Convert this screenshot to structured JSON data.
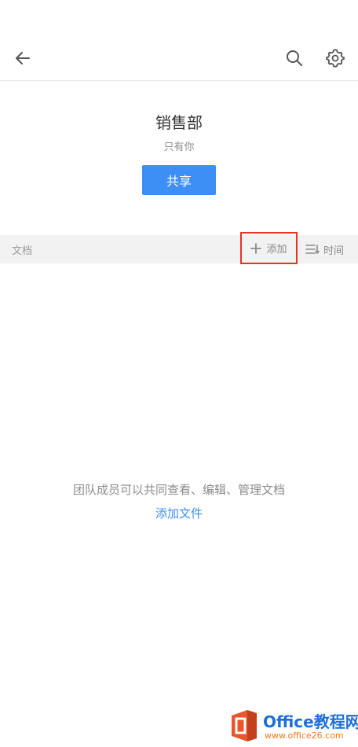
{
  "header": {
    "back_icon": "arrow-left-icon",
    "search_icon": "search-icon",
    "settings_icon": "gear-icon"
  },
  "team": {
    "name": "销售部",
    "members": "只有你",
    "share_label": "共享"
  },
  "docs_bar": {
    "label": "文档",
    "add_label": "添加",
    "add_icon": "plus-icon",
    "sort_label": "时间",
    "sort_icon": "sort-icon",
    "highlight_color": "#ea3323"
  },
  "empty_state": {
    "message": "团队成员可以共同查看、编辑、管理文档",
    "link_label": "添加文件"
  },
  "watermark": {
    "name": "Office教程网",
    "url": "www.office26.com"
  },
  "colors": {
    "accent": "#3d8ff6",
    "text_primary": "#333333",
    "text_secondary": "#8c8c8c",
    "bar_background": "#f2f2f2"
  }
}
